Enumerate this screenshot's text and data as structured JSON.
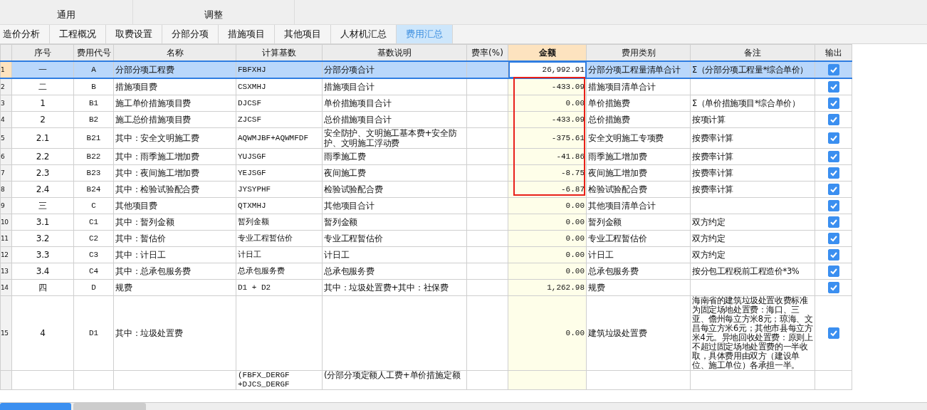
{
  "ribbon": {
    "groups": [
      "通用",
      "调整"
    ]
  },
  "tabs": [
    {
      "label": "造价分析",
      "selected": false
    },
    {
      "label": "工程概况",
      "selected": false
    },
    {
      "label": "取费设置",
      "selected": false
    },
    {
      "label": "分部分项",
      "selected": false
    },
    {
      "label": "措施项目",
      "selected": false
    },
    {
      "label": "其他项目",
      "selected": false
    },
    {
      "label": "人材机汇总",
      "selected": false
    },
    {
      "label": "费用汇总",
      "selected": true
    }
  ],
  "table": {
    "columns": [
      "序号",
      "费用代号",
      "名称",
      "计算基数",
      "基数说明",
      "费率(%)",
      "金额",
      "费用类别",
      "备注",
      "输出"
    ],
    "rows": [
      {
        "row_no": "1",
        "seq": "一",
        "code": "A",
        "name": "分部分项工程费",
        "base": "FBFXHJ",
        "base_desc": "分部分项合计",
        "amount": "26,992.91",
        "category": "分部分项工程量清单合计",
        "note": "Σ（分部分项工程量*综合单价）",
        "output": true,
        "selected": true
      },
      {
        "row_no": "2",
        "seq": "二",
        "code": "B",
        "name": "措施项目费",
        "base": "CSXMHJ",
        "base_desc": "措施项目合计",
        "amount": "-433.09",
        "category": "措施项目清单合计",
        "output": true,
        "selected": false
      },
      {
        "row_no": "3",
        "seq": "1",
        "code": "B1",
        "name": "施工单价措施项目费",
        "base": "DJCSF",
        "base_desc": "单价措施项目合计",
        "amount": "0.00",
        "category": "单价措施费",
        "note": "Σ（单价措施项目*综合单价）",
        "output": true,
        "selected": false
      },
      {
        "row_no": "4",
        "seq": "2",
        "code": "B2",
        "name": "施工总价措施项目费",
        "base": "ZJCSF",
        "base_desc": "总价措施项目合计",
        "amount": "-433.09",
        "category": "总价措施费",
        "note": "按项计算",
        "output": true,
        "selected": false
      },
      {
        "row_no": "5",
        "seq": "2.1",
        "code": "B21",
        "name": "其中：安全文明施工费",
        "base": "AQWMJBF+AQWMFDF",
        "base_desc": "安全防护、文明施工基本费+安全防护、文明施工浮动费",
        "amount": "-375.61",
        "category": "安全文明施工专项费",
        "note": "按费率计算",
        "output": true,
        "selected": false
      },
      {
        "row_no": "6",
        "seq": "2.2",
        "code": "B22",
        "name": "其中：雨季施工增加费",
        "base": "YUJSGF",
        "base_desc": "雨季施工费",
        "amount": "-41.86",
        "category": "雨季施工增加费",
        "note": "按费率计算",
        "output": true,
        "selected": false
      },
      {
        "row_no": "7",
        "seq": "2.3",
        "code": "B23",
        "name": "其中：夜间施工增加费",
        "base": "YEJSGF",
        "base_desc": "夜间施工费",
        "amount": "-8.75",
        "category": "夜间施工增加费",
        "note": "按费率计算",
        "output": true,
        "selected": false
      },
      {
        "row_no": "8",
        "seq": "2.4",
        "code": "B24",
        "name": "其中：检验试验配合费",
        "base": "JYSYPHF",
        "base_desc": "检验试验配合费",
        "amount": "-6.87",
        "category": "检验试验配合费",
        "note": "按费率计算",
        "output": true,
        "selected": false
      },
      {
        "row_no": "9",
        "seq": "三",
        "code": "C",
        "name": "其他项目费",
        "base": "QTXMHJ",
        "base_desc": "其他项目合计",
        "amount": "0.00",
        "category": "其他项目清单合计",
        "output": true,
        "selected": false
      },
      {
        "row_no": "10",
        "seq": "3.1",
        "code": "C1",
        "name": "其中：暂列金额",
        "base": "暂列金额",
        "base_desc": "暂列金额",
        "amount": "0.00",
        "category": "暂列金额",
        "note": "双方约定",
        "output": true,
        "selected": false
      },
      {
        "row_no": "11",
        "seq": "3.2",
        "code": "C2",
        "name": "其中：暂估价",
        "base": "专业工程暂估价",
        "base_desc": "专业工程暂估价",
        "amount": "0.00",
        "category": "专业工程暂估价",
        "note": "双方约定",
        "output": true,
        "selected": false
      },
      {
        "row_no": "12",
        "seq": "3.3",
        "code": "C3",
        "name": "其中：计日工",
        "base": "计日工",
        "base_desc": "计日工",
        "amount": "0.00",
        "category": "计日工",
        "note": "双方约定",
        "output": true,
        "selected": false
      },
      {
        "row_no": "13",
        "seq": "3.4",
        "code": "C4",
        "name": "其中：总承包服务费",
        "base": "总承包服务费",
        "base_desc": "总承包服务费",
        "amount": "0.00",
        "category": "总承包服务费",
        "note": "按分包工程税前工程造价*3%",
        "output": true,
        "selected": false
      },
      {
        "row_no": "14",
        "seq": "四",
        "code": "D",
        "name": "规费",
        "base": "D1 + D2",
        "base_desc": "其中：垃圾处置费+其中：社保费",
        "amount": "1,262.98",
        "category": "规费",
        "output": true,
        "selected": false
      },
      {
        "row_no": "15",
        "seq": "4",
        "code": "D1",
        "name": "其中：垃圾处置费",
        "amount": "0.00",
        "category": "建筑垃圾处置费",
        "note": "海南省的建筑垃圾处置收费标准为固定场地处置费：海口、三亚、儋州每立方米8元；琼海、文昌每立方米6元；其他市县每立方米4元。异地回收处置费：原则上不超过固定场地处置费的一半收取，具体费用由双方（建设单位、施工单位）各承担一半。",
        "output": true,
        "selected": false
      },
      {
        "base": "(FBFX_DERGF\n+DJCS_DERGF",
        "base_desc": "(分部分项定额人工费+单价措施定额",
        "selected": false
      }
    ]
  }
}
